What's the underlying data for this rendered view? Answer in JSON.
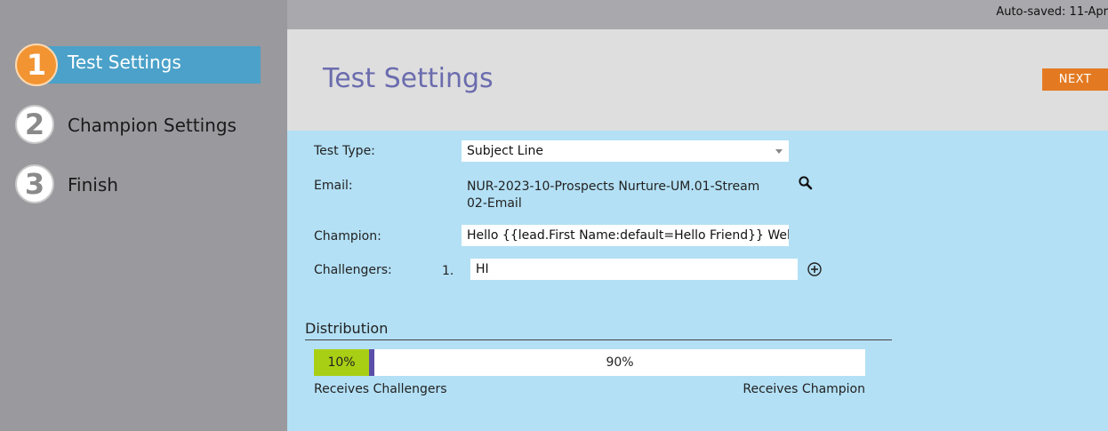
{
  "sidebar": {
    "steps": [
      {
        "number": "1",
        "label": "Test Settings"
      },
      {
        "number": "2",
        "label": "Champion Settings"
      },
      {
        "number": "3",
        "label": "Finish"
      }
    ]
  },
  "topbar": {
    "autosaved": "Auto-saved: 11-Apr"
  },
  "header": {
    "title": "Test Settings",
    "next_label": "NEXT"
  },
  "form": {
    "test_type_label": "Test Type:",
    "test_type_value": "Subject Line",
    "email_label": "Email:",
    "email_value": "NUR-2023-10-Prospects Nurture-UM.01-Stream 02-Email",
    "champion_label": "Champion:",
    "champion_value": "Hello {{lead.First Name:default=Hello Friend}} Welcome",
    "challengers_label": "Challengers:",
    "challenger_number": "1.",
    "challenger_value": "HI"
  },
  "distribution": {
    "title": "Distribution",
    "challenger_pct_label": "10%",
    "champion_pct_label": "90%",
    "challenger_fraction": 0.1,
    "challenger_caption": "Receives Challengers",
    "champion_caption": "Receives Champion",
    "challenger_color": "#a9cf14",
    "handle_color": "#5a4ea8"
  }
}
